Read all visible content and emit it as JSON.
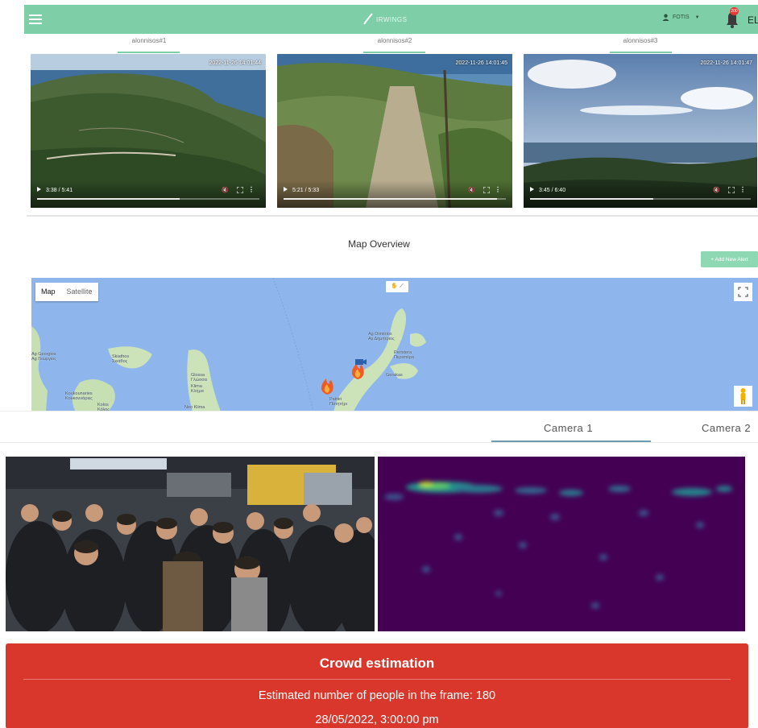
{
  "app": {
    "logo_text": "IRWINGS",
    "user_name": "FOTIS",
    "notification_count": "200",
    "language": "EL",
    "theme_color": "#7ecfa8"
  },
  "cameras": [
    {
      "tab": "alonnisos#1",
      "timestamp": "2022-11-26 14:01:44",
      "time": "3:38 / 5:41",
      "progress": 0.64
    },
    {
      "tab": "alonnisos#2",
      "timestamp": "2022-11-26 14:01:45",
      "time": "5:21 / 5:33",
      "progress": 0.96
    },
    {
      "tab": "alonnisos#3",
      "timestamp": "2022-11-26 14:01:47",
      "time": "3:45 / 6:40",
      "progress": 0.56
    }
  ],
  "map_section": {
    "title": "Map Overview",
    "add_alert_label": "+ Add New Alert",
    "map_type_map": "Map",
    "map_type_satellite": "Satellite",
    "places": [
      "Ag Georgios\nAg Γεώργιος",
      "Kolos\nΚόλος",
      "Skiathos\nΣκιάθος",
      "Glossa\nΓλώσσα",
      "Klima\nΚλήμα",
      "Neo Klima",
      "Ag Dimitrios\nΑγ Δημήτριος",
      "Patitiri\nΠατητήρι",
      "Peristera\nΠεριστέρα",
      "Gerakas",
      "Koukounaries\nΚουκουνάριες"
    ]
  },
  "crowd": {
    "tabs": [
      "Camera 1",
      "Camera 2"
    ],
    "active_tab": 0,
    "card_title": "Crowd estimation",
    "count_text": "Estimated number of people in the frame: 180",
    "date_text": "28/05/2022, 3:00:00 pm",
    "card_color": "#d9372c",
    "heatmap_base": "#440154"
  }
}
